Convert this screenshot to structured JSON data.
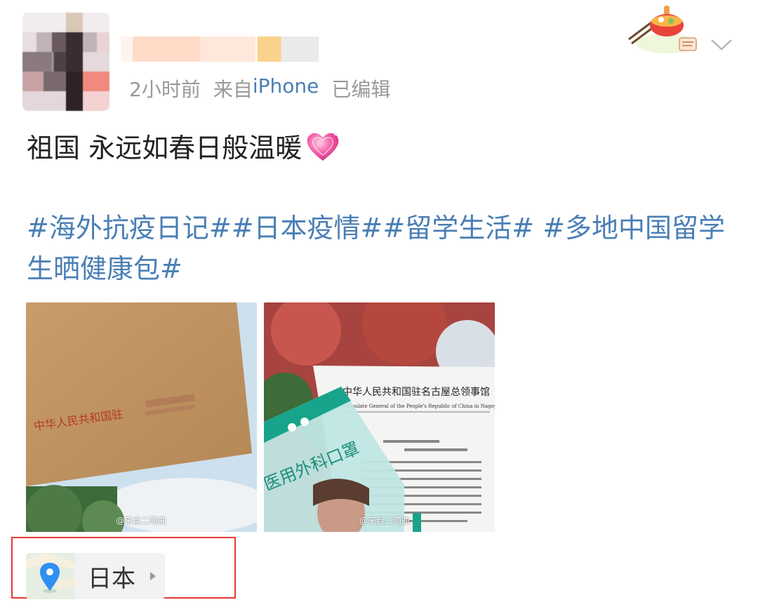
{
  "post": {
    "meta": {
      "time": "2小时前",
      "source_prefix": "来自",
      "source": "iPhone",
      "edited": "已编辑"
    },
    "text": "祖国 永远如春日般温暖",
    "hashtags": [
      "#海外抗疫日记#",
      "#日本疫情#",
      "#留学生活#",
      " #多地中国留学生晒健康包#"
    ],
    "photos": [
      {
        "envelope_text": "中华人民共和国驻",
        "watermark": "@来自二萌曲"
      },
      {
        "sheet_title": "中华人民共和国驻名古屋总领事馆",
        "sheet_subtitle": "Consulate General of the People's Republic of China in Nagoya",
        "mask_text": "医用外科口罩",
        "watermark": "@来自二萌曲"
      }
    ],
    "location": "日本"
  },
  "icons": {
    "heart": "sparkling-heart-icon",
    "chevron": "chevron-down-icon",
    "location_pin": "map-pin-icon",
    "arrow": "caret-right-icon"
  },
  "colors": {
    "link": "#4a7fb5",
    "meta": "#999999",
    "highlight": "#e53935"
  }
}
